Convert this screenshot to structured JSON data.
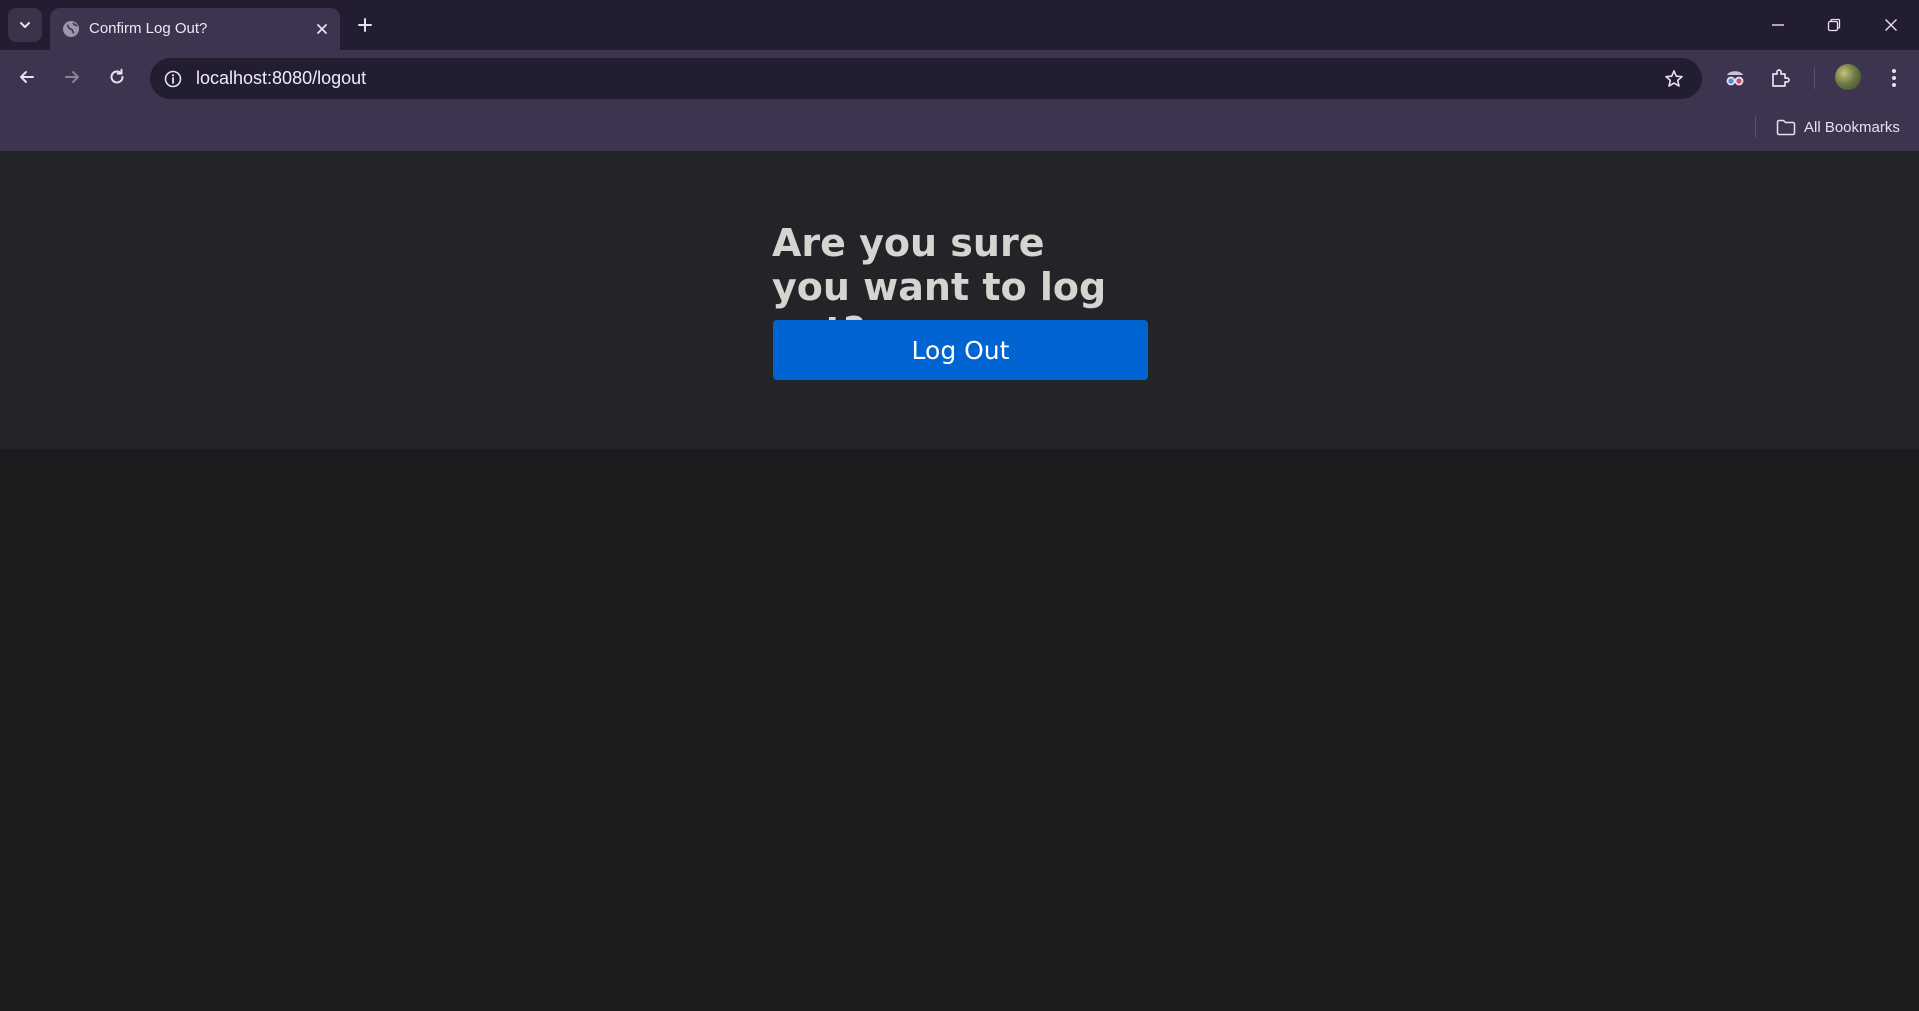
{
  "browser": {
    "tab": {
      "title": "Confirm Log Out?",
      "favicon": "globe-icon"
    },
    "address_bar": {
      "url": "localhost:8080/logout"
    },
    "bookmarks_bar": {
      "all_bookmarks_label": "All Bookmarks"
    },
    "colors": {
      "frame": "#231d31",
      "toolbar": "#3d3450"
    }
  },
  "page": {
    "heading": "Are you sure you want to log out?",
    "logout_button_label": "Log Out",
    "colors": {
      "hero_background": "#232427",
      "page_background": "#1b1c1e",
      "button": "#0064d2"
    }
  }
}
